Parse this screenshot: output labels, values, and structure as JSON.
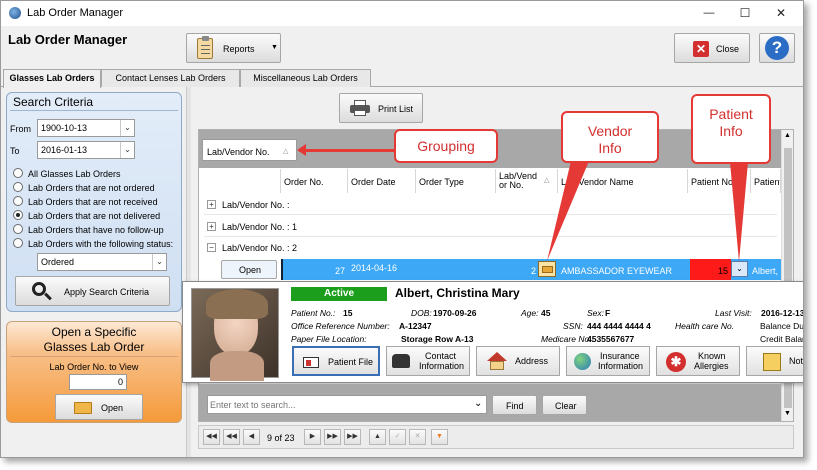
{
  "window": {
    "title": "Lab Order Manager",
    "minimize_glyph": "—",
    "maximize_glyph": "☐",
    "close_glyph": "✕"
  },
  "header": {
    "title": "Lab Order Manager",
    "reports_label": "Reports",
    "close_label": "Close",
    "help_glyph": "?"
  },
  "tabs": [
    "Glasses Lab Orders",
    "Contact Lenses Lab Orders",
    "Miscellaneous Lab Orders"
  ],
  "search": {
    "title": "Search Criteria",
    "from_label": "From",
    "from_value": "1900-10-13",
    "to_label": "To",
    "to_value": "2016-01-13",
    "options": [
      "All Glasses Lab Orders",
      "Lab Orders that are not ordered",
      "Lab Orders that are not received",
      "Lab Orders that are not delivered",
      "Lab Orders that have no follow-up",
      "Lab Orders with the following status:"
    ],
    "selected_index": 3,
    "status_value": "Ordered",
    "apply_label": "Apply Search Criteria"
  },
  "open_panel": {
    "title_line1": "Open a Specific",
    "title_line2": "Glasses Lab Order",
    "field_label": "Lab Order No. to View",
    "field_value": "0",
    "open_label": "Open"
  },
  "print_list_label": "Print List",
  "grid": {
    "group_header": "Lab/Vendor No.",
    "sort_glyph": "△",
    "columns": [
      "Order No.",
      "Order Date",
      "Order Type",
      "Lab/Vend or No.",
      "Lab Vendor Name",
      "Patient No.",
      "Patient"
    ],
    "groups": [
      "Lab/Vendor No. : ",
      "Lab/Vendor No. : 1",
      "Lab/Vendor No. : 2"
    ],
    "row": {
      "open_label": "Open",
      "order_no": "27",
      "order_date": "2014-04-16",
      "lab_vendor_no": "2",
      "vendor_name": "AMBASSADOR EYEWEAR",
      "patient_no": "15",
      "patient": "Albert,"
    }
  },
  "patient_card": {
    "status": "Active",
    "name": "Albert, Christina Mary",
    "patient_no_label": "Patient No.:",
    "patient_no": "15",
    "dob_label": "DOB:",
    "dob": "1970-09-26",
    "age_label": "Age:",
    "age": "45",
    "sex_label": "Sex:",
    "sex": "F",
    "last_visit_label": "Last Visit:",
    "last_visit": "2016-12-13",
    "office_ref_label": "Office Reference Number:",
    "office_ref": "A-12347",
    "ssn_label": "SSN:",
    "ssn": "444 4444 4444 4",
    "health_card_label": "Health care No.",
    "balance_due": "Balance Du",
    "paper_file_label": "Paper File Location:",
    "paper_file": "Storage Row A-13",
    "medicare_label": "Medicare No.:",
    "medicare": "4535567677",
    "credit_balance": "Credit Balan",
    "buttons": [
      "Patient File",
      "Contact",
      "Information",
      "Address",
      "Insurance",
      "Information",
      "Known",
      "Allergies",
      "Not"
    ]
  },
  "search_bar": {
    "placeholder": "Enter text to search...",
    "find_label": "Find",
    "clear_label": "Clear"
  },
  "pager": {
    "text": "9 of 23"
  },
  "callouts": {
    "grouping": "Grouping",
    "vendor_line1": "Vendor",
    "vendor_line2": "Info",
    "patient_line1": "Patient",
    "patient_line2": "Info"
  },
  "colors": {
    "selected_row": "#3da8f5",
    "patient_no_bg": "#ff1a1a",
    "active_badge": "#1b9e1b",
    "callout": "#e53935",
    "open_panel": "#f59a3a"
  }
}
